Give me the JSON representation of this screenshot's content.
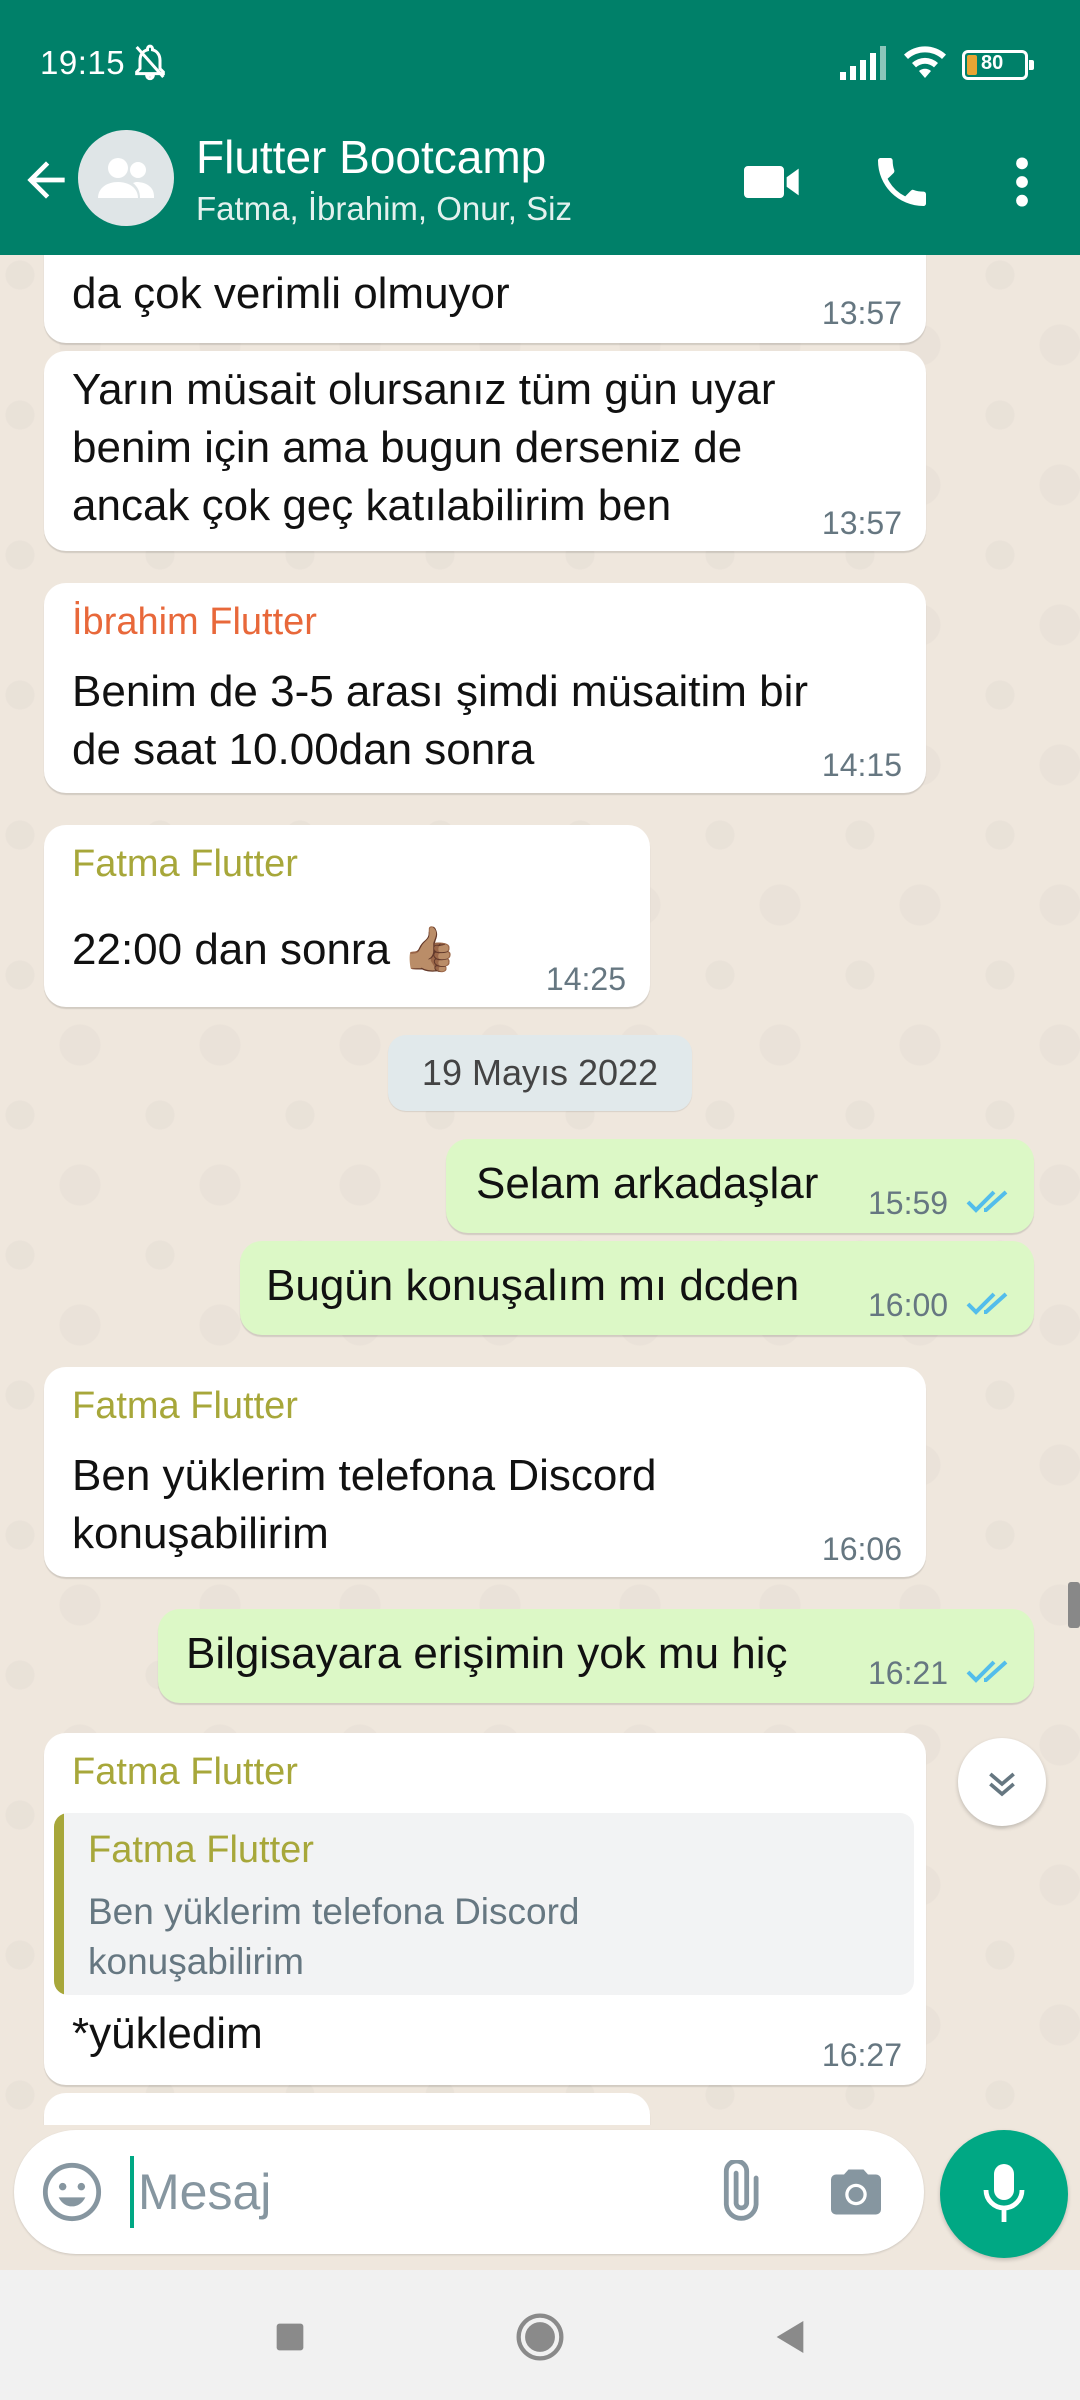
{
  "status_bar": {
    "time": "19:15",
    "battery": "80"
  },
  "header": {
    "title": "Flutter Bootcamp",
    "subtitle": "Fatma, İbrahim, Onur, Siz"
  },
  "colors": {
    "header_bg": "#008069",
    "incoming_bubble": "#ffffff",
    "outgoing_bubble": "#dcf8c6",
    "sender_ibrahim": "#e8683a",
    "sender_fatma": "#a7a73a",
    "read_ticks": "#53bdeb",
    "accent": "#00a884"
  },
  "messages": [
    {
      "type": "in",
      "text": "da çok verimli olmuyor",
      "time": "13:57"
    },
    {
      "type": "in",
      "text": "Yarın müsait olursanız tüm gün uyar\nbenim için ama bugun derseniz de\nancak çok geç katılabilirim ben",
      "time": "13:57"
    },
    {
      "type": "in",
      "sender": "İbrahim Flutter",
      "text": "Benim de 3-5 arası şimdi müsaitim bir\nde saat 10.00dan sonra",
      "time": "14:15"
    },
    {
      "type": "in",
      "sender": "Fatma Flutter",
      "text": "22:00 dan sonra 👍🏽",
      "time": "14:25"
    },
    {
      "type": "date",
      "text": "19 Mayıs 2022"
    },
    {
      "type": "out",
      "text": "Selam arkadaşlar",
      "time": "15:59",
      "status": "read"
    },
    {
      "type": "out",
      "text": "Bugün konuşalım mı dcden",
      "time": "16:00",
      "status": "read"
    },
    {
      "type": "in",
      "sender": "Fatma Flutter",
      "text": "Ben yüklerim telefona Discord\nkonuşabilirim",
      "time": "16:06"
    },
    {
      "type": "out",
      "text": "Bilgisayara erişimin yok mu hiç",
      "time": "16:21",
      "status": "read"
    },
    {
      "type": "in",
      "sender": "Fatma Flutter",
      "quote": {
        "sender": "Fatma Flutter",
        "text": "Ben yüklerim telefona Discord\nkonuşabilirim"
      },
      "text": "*yükledim",
      "time": "16:27"
    }
  ],
  "input": {
    "placeholder": "Mesaj",
    "value": ""
  },
  "icons": [
    "bell-off-icon",
    "signal-icon",
    "wifi-icon",
    "battery-icon",
    "back-arrow-icon",
    "group-avatar-icon",
    "video-call-icon",
    "phone-icon",
    "more-vert-icon",
    "read-ticks-icon",
    "chevron-down-icon",
    "emoji-icon",
    "attach-icon",
    "camera-icon",
    "mic-icon",
    "recents-icon",
    "home-icon",
    "nav-back-icon"
  ]
}
